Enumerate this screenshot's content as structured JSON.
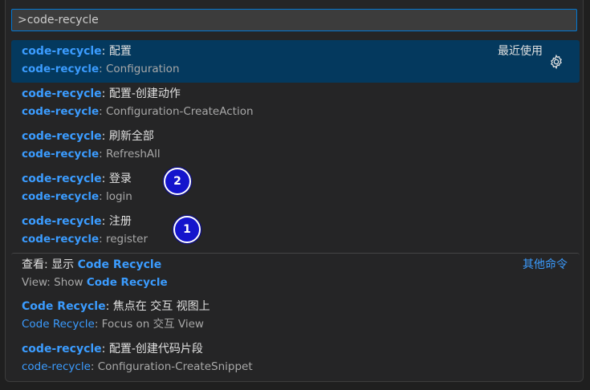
{
  "search": {
    "value": ">code-recycle"
  },
  "items": [
    {
      "prefix": "code-recycle",
      "sep": ": ",
      "title": "配置",
      "desc_prefix": "code-recycle",
      "desc": ": Configuration",
      "right": "最近使用"
    },
    {
      "prefix": "code-recycle",
      "sep": ": ",
      "title": "配置-创建动作",
      "desc_prefix": "code-recycle",
      "desc": ": Configuration-CreateAction"
    },
    {
      "prefix": "code-recycle",
      "sep": ": ",
      "title": "刷新全部",
      "desc_prefix": "code-recycle",
      "desc": ": RefreshAll"
    },
    {
      "prefix": "code-recycle",
      "sep": ": ",
      "title": "登录",
      "desc_prefix": "code-recycle",
      "desc": ": login"
    },
    {
      "prefix": "code-recycle",
      "sep": ": ",
      "title": "注册",
      "desc_prefix": "code-recycle",
      "desc": ": register"
    },
    {
      "pre": "查看: 显示 ",
      "prefix": "Code Recycle",
      "desc_pre": "View: Show ",
      "desc_prefix": "Code Recycle",
      "right": "其他命令"
    },
    {
      "prefix": "Code Recycle",
      "sep": ": ",
      "title": "焦点在 交互 视图上",
      "desc_prefix": "Code Recycle",
      "desc": ": Focus on 交互 View"
    },
    {
      "prefix": "code-recycle",
      "sep": ": ",
      "title": "配置-创建代码片段",
      "desc_prefix": "code-recycle",
      "desc": ": Configuration-CreateSnippet"
    }
  ],
  "badges": [
    {
      "label": "2"
    },
    {
      "label": "1"
    }
  ],
  "colors": {
    "accent": "#3b9cff",
    "selected_bg": "#04395e",
    "badge_bg": "#1414cc"
  }
}
